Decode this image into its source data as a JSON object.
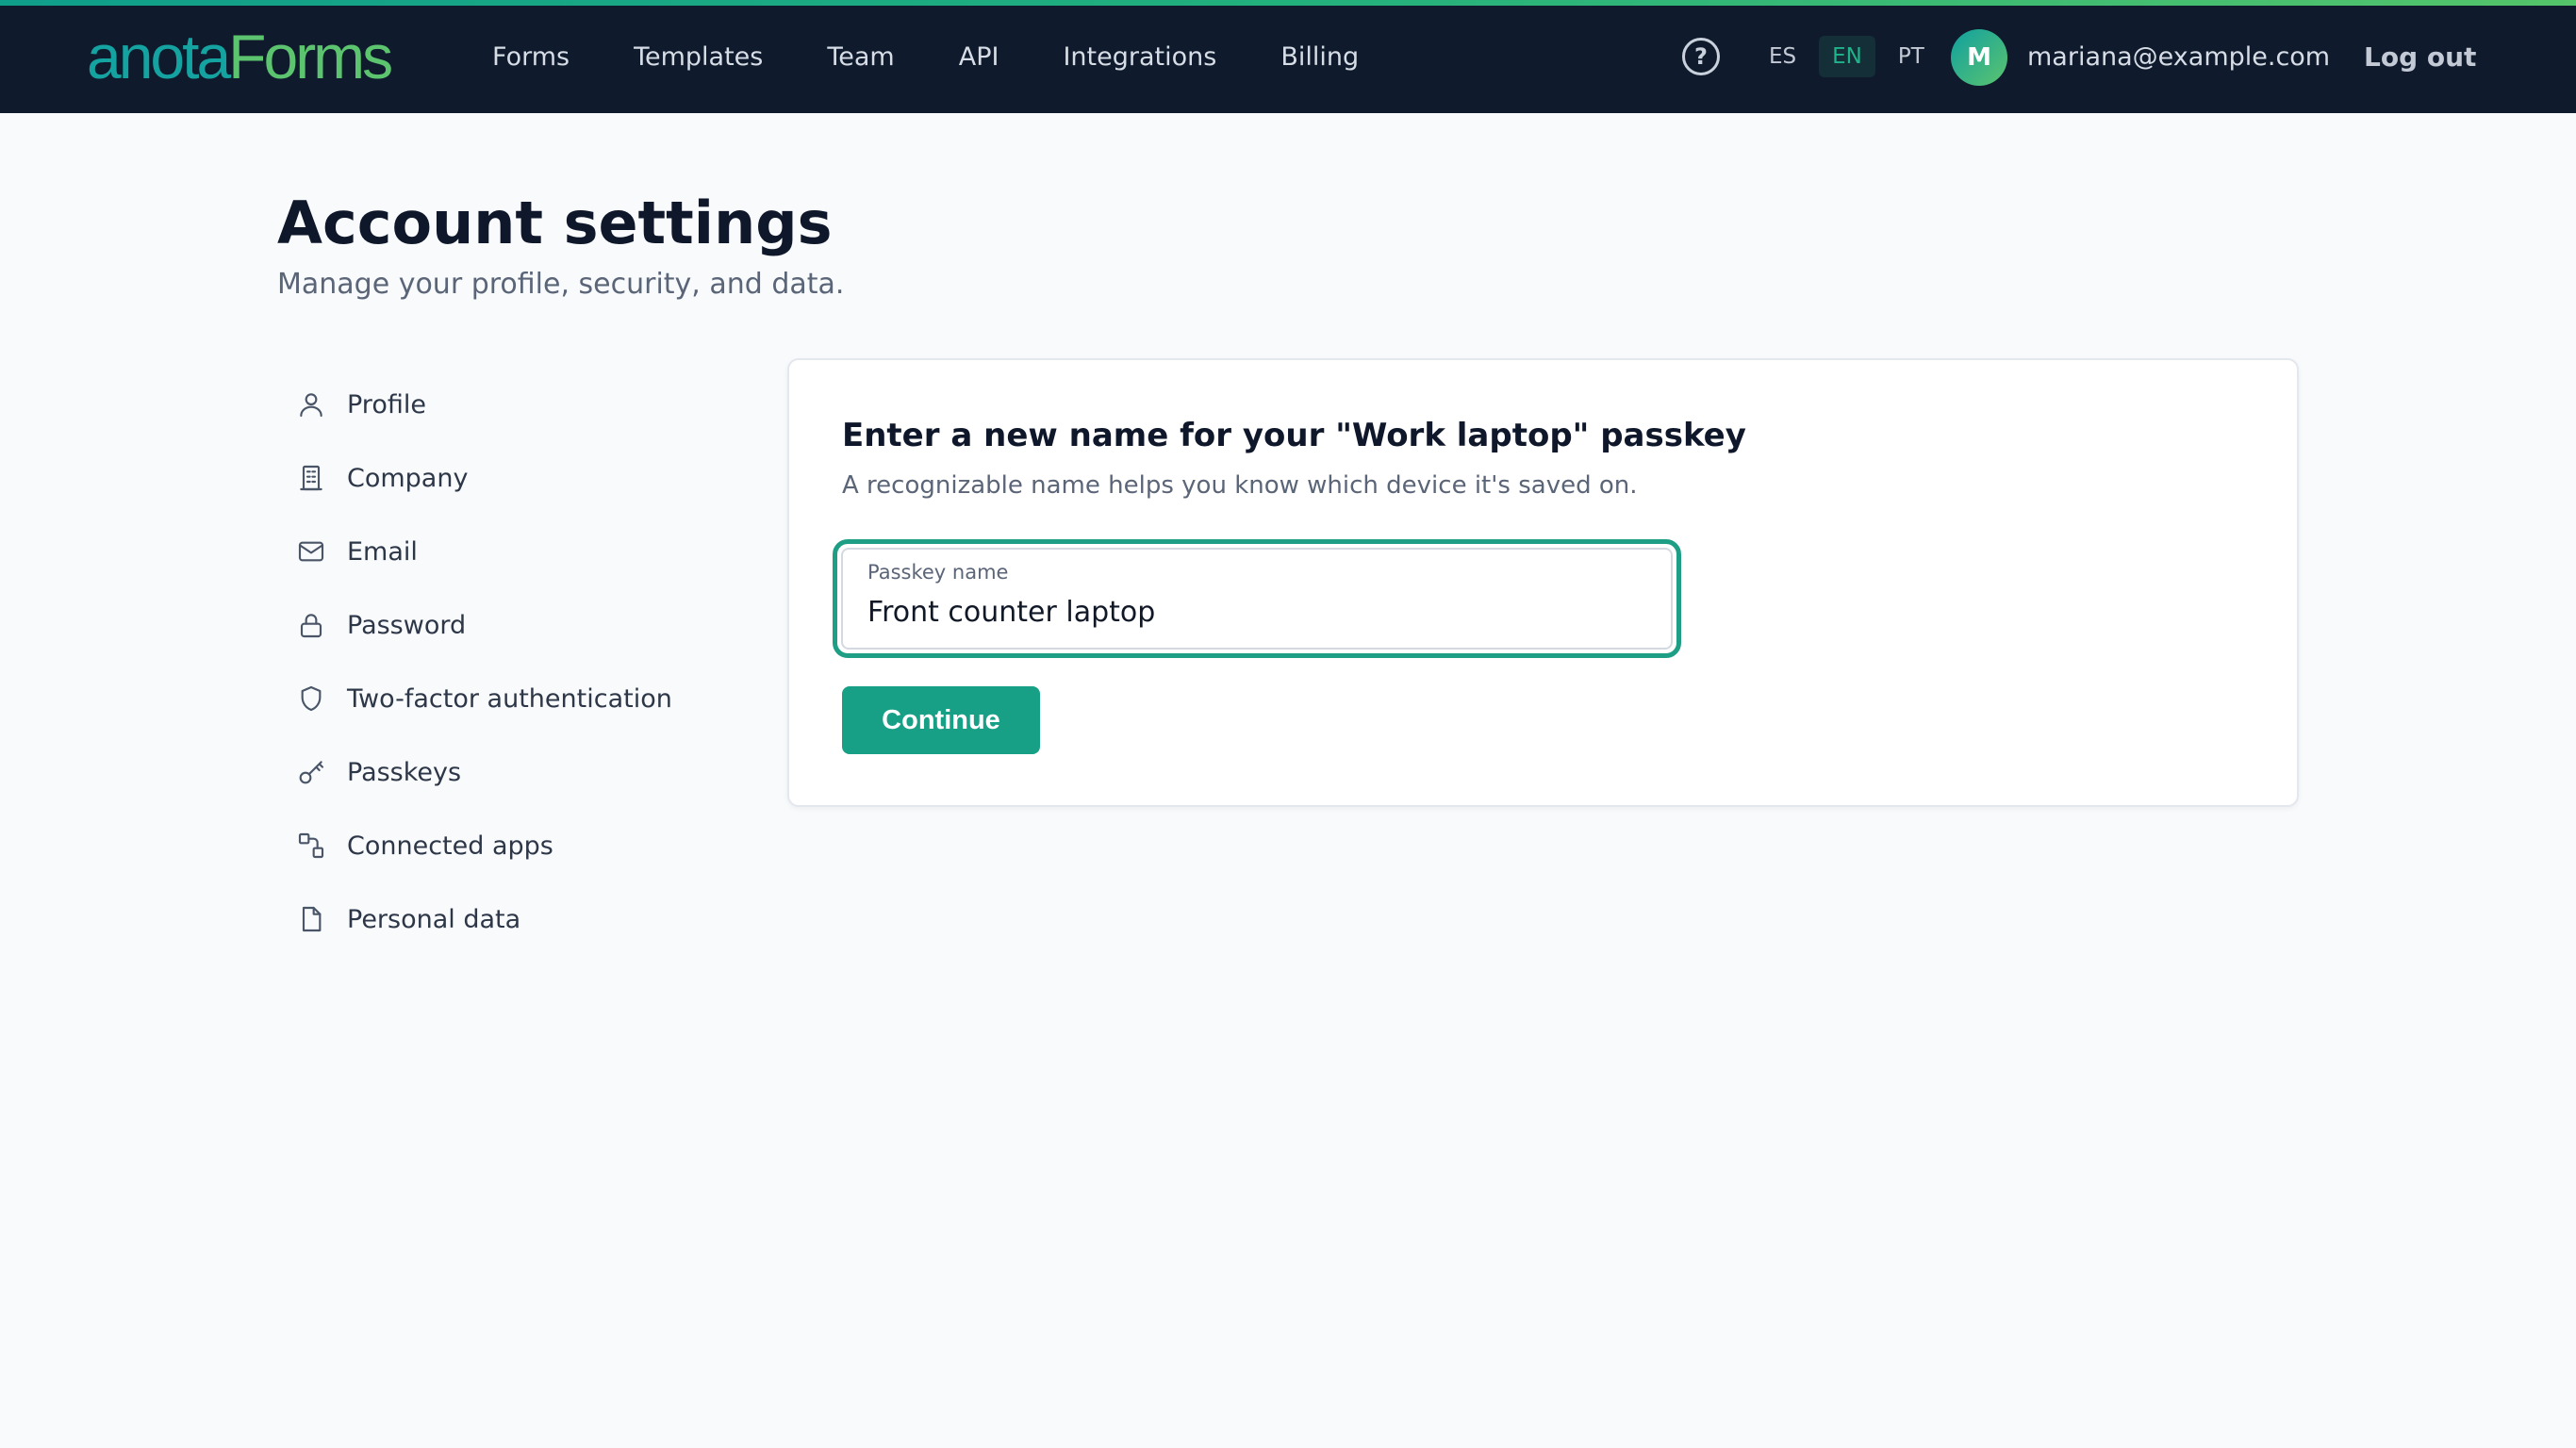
{
  "brand": {
    "logo_part1": "anota",
    "logo_part2": "Forms"
  },
  "nav": {
    "items": [
      {
        "label": "Forms"
      },
      {
        "label": "Templates"
      },
      {
        "label": "Team"
      },
      {
        "label": "API"
      },
      {
        "label": "Integrations"
      },
      {
        "label": "Billing"
      }
    ]
  },
  "header_right": {
    "help_icon": "question-circle-icon",
    "languages": [
      {
        "code": "ES",
        "active": false
      },
      {
        "code": "EN",
        "active": true
      },
      {
        "code": "PT",
        "active": false
      }
    ],
    "avatar_initial": "M",
    "user_email": "mariana@example.com",
    "logout_label": "Log out"
  },
  "page": {
    "title": "Account settings",
    "subtitle": "Manage your profile, security, and data."
  },
  "sidebar": {
    "items": [
      {
        "label": "Profile",
        "icon": "user-icon"
      },
      {
        "label": "Company",
        "icon": "building-icon"
      },
      {
        "label": "Email",
        "icon": "mail-icon"
      },
      {
        "label": "Password",
        "icon": "lock-icon"
      },
      {
        "label": "Two-factor authentication",
        "icon": "shield-icon"
      },
      {
        "label": "Passkeys",
        "icon": "key-icon"
      },
      {
        "label": "Connected apps",
        "icon": "connected-apps-icon"
      },
      {
        "label": "Personal data",
        "icon": "document-icon"
      }
    ]
  },
  "rename_passkey": {
    "title": "Enter a new name for your \"Work laptop\" passkey",
    "description": "A recognizable name helps you know which device it's saved on.",
    "field_label": "Passkey name",
    "field_value": "Front counter laptop",
    "continue_label": "Continue"
  },
  "colors": {
    "topbar_bg": "#0f1b2d",
    "accent": "#18a086",
    "logo_teal": "#14a3a0",
    "logo_green": "#5cc46e",
    "page_bg": "#f8fafc"
  }
}
